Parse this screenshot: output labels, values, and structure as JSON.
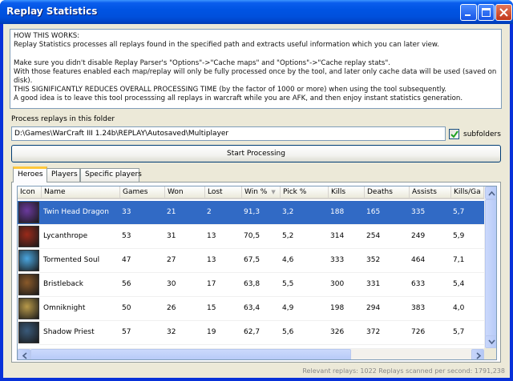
{
  "window": {
    "title": "Replay Statistics"
  },
  "info": {
    "lines": [
      "HOW THIS WORKS:",
      "Replay Statistics processes all replays found in the specified path and extracts useful information which you can later view.",
      "",
      "Make sure you didn't disable Replay Parser's \"Options\"->\"Cache maps\" and \"Options\"->\"Cache replay stats\".",
      "With those features enabled each map/replay will only be fully processed once by the tool, and later only cache data will be used (saved on",
      "disk).",
      "THIS SIGNIFICANTLY REDUCES OVERALL PROCESSING TIME (by the factor of 1000 or more) when using the tool subsequently.",
      "A good idea is to leave this tool processsing all replays in warcraft while you are AFK, and then enjoy instant statistics generation."
    ]
  },
  "folder": {
    "label": "Process replays in this folder",
    "path": "D:\\Games\\WarCraft III 1.24b\\REPLAY\\Autosaved\\Multiplayer",
    "subfolders_label": "subfolders",
    "subfolders_checked": true
  },
  "start_button": "Start Processing",
  "tabs": [
    "Heroes",
    "Players",
    "Specific players"
  ],
  "active_tab": "Heroes",
  "grid": {
    "columns": [
      "Icon",
      "Name",
      "Games",
      "Won",
      "Lost",
      "Win %",
      "Pick %",
      "Kills",
      "Deaths",
      "Assists",
      "Kills/Ga"
    ],
    "sorted_column": "Win %",
    "rows": [
      {
        "name": "Twin Head Dragon",
        "games": "33",
        "won": "21",
        "lost": "2",
        "win": "91,3",
        "pick": "3,2",
        "kills": "188",
        "deaths": "165",
        "assists": "335",
        "kpg": "5,7",
        "icon": "twin-head-dragon-icon",
        "color": "#6b3a9e",
        "selected": true
      },
      {
        "name": "Lycanthrope",
        "games": "53",
        "won": "31",
        "lost": "13",
        "win": "70,5",
        "pick": "5,2",
        "kills": "314",
        "deaths": "254",
        "assists": "249",
        "kpg": "5,9",
        "icon": "lycanthrope-icon",
        "color": "#9a2a1a",
        "selected": false
      },
      {
        "name": "Tormented Soul",
        "games": "47",
        "won": "27",
        "lost": "13",
        "win": "67,5",
        "pick": "4,6",
        "kills": "333",
        "deaths": "352",
        "assists": "464",
        "kpg": "7,1",
        "icon": "tormented-soul-icon",
        "color": "#4aa6e0",
        "selected": false
      },
      {
        "name": "Bristleback",
        "games": "56",
        "won": "30",
        "lost": "17",
        "win": "63,8",
        "pick": "5,5",
        "kills": "300",
        "deaths": "331",
        "assists": "633",
        "kpg": "5,4",
        "icon": "bristleback-icon",
        "color": "#8a5a2a",
        "selected": false
      },
      {
        "name": "Omniknight",
        "games": "50",
        "won": "26",
        "lost": "15",
        "win": "63,4",
        "pick": "4,9",
        "kills": "198",
        "deaths": "294",
        "assists": "383",
        "kpg": "4,0",
        "icon": "omniknight-icon",
        "color": "#b89a4a",
        "selected": false
      },
      {
        "name": "Shadow Priest",
        "games": "57",
        "won": "32",
        "lost": "19",
        "win": "62,7",
        "pick": "5,6",
        "kills": "326",
        "deaths": "372",
        "assists": "726",
        "kpg": "5,7",
        "icon": "shadow-priest-icon",
        "color": "#3a5a7a",
        "selected": false
      }
    ]
  },
  "status": {
    "text": "Relevant replays: 1022   Replays scanned per second: 1791,238"
  },
  "colors": {
    "selection": "#316ac5",
    "titlebar": "#0054e3",
    "client": "#ece9d8",
    "tab_accent": "#ffc83c"
  }
}
